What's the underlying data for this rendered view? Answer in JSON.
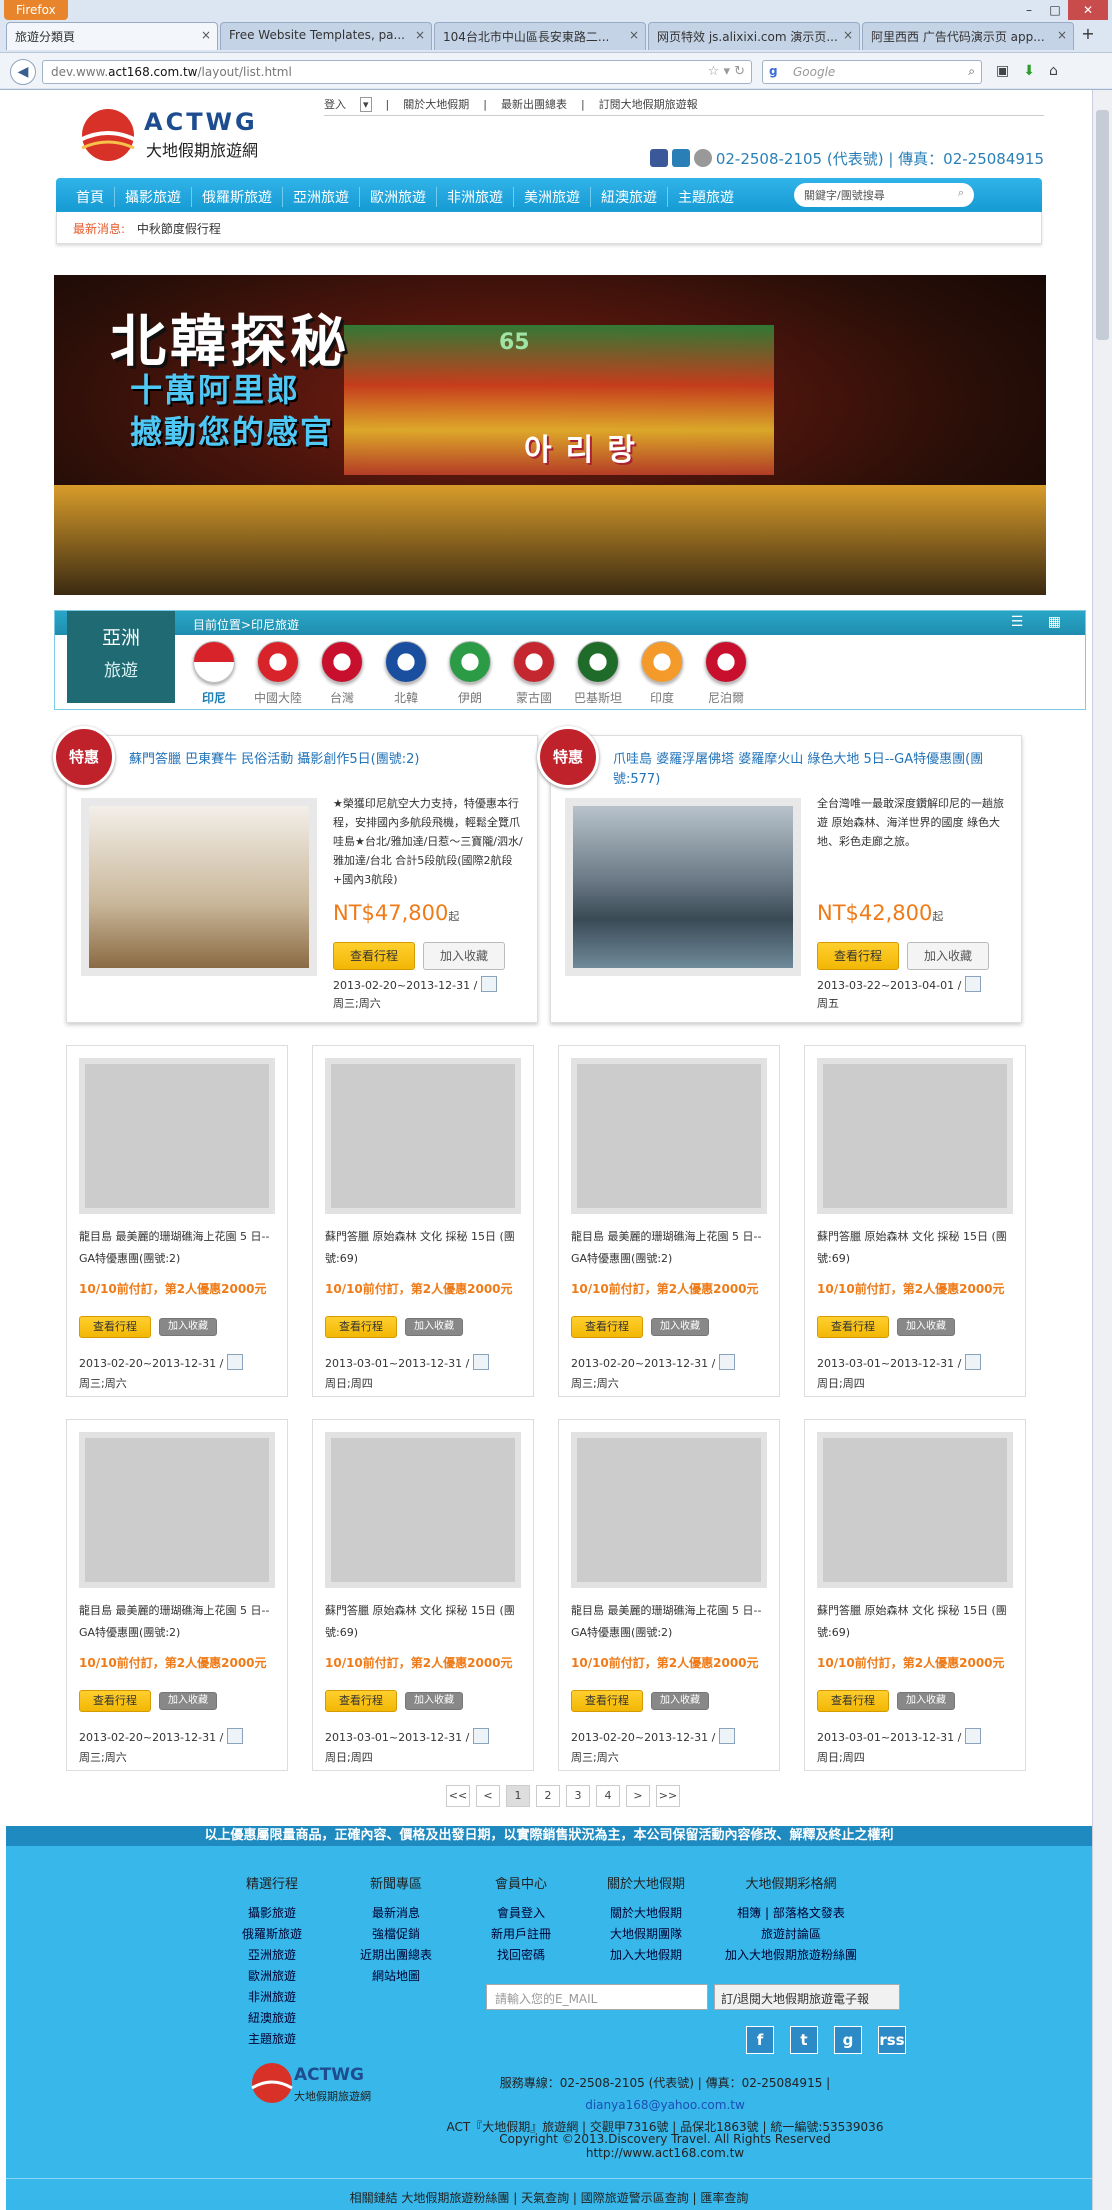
{
  "browser": {
    "menu_button": "Firefox",
    "tabs": [
      "旅遊分類頁",
      "Free Website Templates, pa...",
      "104台北市中山區長安東路二...",
      "网页特效 js.alixixi.com 演示页...",
      "阿里西西 广告代码演示页 app..."
    ],
    "url_prefix": "dev.www.",
    "url_domain": "act168.com.tw",
    "url_path": "/layout/list.html",
    "search_placeholder": "Google"
  },
  "header": {
    "top_links": [
      "登入",
      "關於大地假期",
      "最新出團總表",
      "訂閱大地假期旅遊報"
    ],
    "logo_text": "ACTWG",
    "logo_sub": "大地假期旅遊網",
    "phone": "02-2508-2105 (代表號) | 傳真：02-25084915"
  },
  "nav": {
    "items": [
      "首頁",
      "攝影旅遊",
      "俄羅斯旅遊",
      "亞洲旅遊",
      "歐洲旅遊",
      "非洲旅遊",
      "美洲旅遊",
      "紐澳旅遊",
      "主題旅遊"
    ],
    "keyword_placeholder": "關鍵字/團號搜尋"
  },
  "news": {
    "label": "最新消息:",
    "text": "中秋節度假行程"
  },
  "banner": {
    "title": "北韓探秘",
    "line1": "十萬阿里郎",
    "line2": "撼動您的感官",
    "number": "65",
    "korean": "아리랑"
  },
  "region": {
    "badge_top": "亞洲",
    "badge_bottom": "旅遊",
    "breadcrumb": "目前位置>印尼旅遊",
    "flags": [
      {
        "name": "印尼",
        "color": "#d8232a",
        "selected": true
      },
      {
        "name": "中國大陸",
        "color": "#d8232a"
      },
      {
        "name": "台灣",
        "color": "#c8102e"
      },
      {
        "name": "北韓",
        "color": "#1a4fa0"
      },
      {
        "name": "伊朗",
        "color": "#2c9b46"
      },
      {
        "name": "蒙古國",
        "color": "#c4272f"
      },
      {
        "name": "巴基斯坦",
        "color": "#1f6b2a"
      },
      {
        "name": "印度",
        "color": "#f39a2b"
      },
      {
        "name": "尼泊爾",
        "color": "#c8102e"
      }
    ]
  },
  "featured": [
    {
      "ribbon": "特惠",
      "title": "蘇門答臘 巴東賽牛 民俗活動 攝影創作5日(團號:2)",
      "desc": "★榮獲印尼航空大力支持，特優惠本行程，安排國內多航段飛機，輕鬆全覽爪哇島★台北/雅加達/日惹～三寶隴/泗水/雅加達/台北 合計5段航段(國際2航段+國內3航段)",
      "price": "NT$47,800",
      "price_suffix": "起",
      "btn_view": "查看行程",
      "btn_fav": "加入收藏",
      "date": "2013-02-20~2013-12-31 /",
      "days": "周三;周六"
    },
    {
      "ribbon": "特惠",
      "title": "爪哇島 婆羅浮屠佛塔 婆羅摩火山 綠色大地 5日--GA特優惠團(團號:577)",
      "desc": "全台灣唯一最敢深度鑽解印尼的一趟旅遊 原始森林、海洋世界的國度 綠色大地、彩色走廊之旅。",
      "price": "NT$42,800",
      "price_suffix": "起",
      "btn_view": "查看行程",
      "btn_fav": "加入收藏",
      "date": "2013-03-22~2013-04-01 /",
      "days": "周五"
    }
  ],
  "cards": [
    {
      "title": "龍目島 最美麗的珊瑚礁海上花園 5 日--GA特優惠團(團號:2)",
      "promo": "10/10前付訂，第2人優惠2000元",
      "btn_view": "查看行程",
      "btn_fav": "加入收藏",
      "date": "2013-02-20~2013-12-31 /",
      "days": "周三;周六",
      "img": "pool"
    },
    {
      "title": "蘇門答臘 原始森林 文化 採秘 15日 (團號:69)",
      "promo": "10/10前付訂，第2人優惠2000元",
      "btn_view": "查看行程",
      "btn_fav": "加入收藏",
      "date": "2013-03-01~2013-12-31 /",
      "days": "周日;周四",
      "img": "hill"
    },
    {
      "title": "龍目島 最美麗的珊瑚礁海上花園 5 日--GA特優惠團(團號:2)",
      "promo": "10/10前付訂，第2人優惠2000元",
      "btn_view": "查看行程",
      "btn_fav": "加入收藏",
      "date": "2013-02-20~2013-12-31 /",
      "days": "周三;周六",
      "img": "pool"
    },
    {
      "title": "蘇門答臘 原始森林 文化 採秘 15日 (團號:69)",
      "promo": "10/10前付訂，第2人優惠2000元",
      "btn_view": "查看行程",
      "btn_fav": "加入收藏",
      "date": "2013-03-01~2013-12-31 /",
      "days": "周日;周四",
      "img": "hill"
    },
    {
      "title": "龍目島 最美麗的珊瑚礁海上花園 5 日--GA特優惠團(團號:2)",
      "promo": "10/10前付訂，第2人優惠2000元",
      "btn_view": "查看行程",
      "btn_fav": "加入收藏",
      "date": "2013-02-20~2013-12-31 /",
      "days": "周三;周六",
      "img": "pool"
    },
    {
      "title": "蘇門答臘 原始森林 文化 採秘 15日 (團號:69)",
      "promo": "10/10前付訂，第2人優惠2000元",
      "btn_view": "查看行程",
      "btn_fav": "加入收藏",
      "date": "2013-03-01~2013-12-31 /",
      "days": "周日;周四",
      "img": "hill"
    },
    {
      "title": "龍目島 最美麗的珊瑚礁海上花園 5 日--GA特優惠團(團號:2)",
      "promo": "10/10前付訂，第2人優惠2000元",
      "btn_view": "查看行程",
      "btn_fav": "加入收藏",
      "date": "2013-02-20~2013-12-31 /",
      "days": "周三;周六",
      "img": "pool"
    },
    {
      "title": "蘇門答臘 原始森林 文化 採秘 15日 (團號:69)",
      "promo": "10/10前付訂，第2人優惠2000元",
      "btn_view": "查看行程",
      "btn_fav": "加入收藏",
      "date": "2013-03-01~2013-12-31 /",
      "days": "周日;周四",
      "img": "hill"
    }
  ],
  "pager": [
    "<<",
    "<",
    "1",
    "2",
    "3",
    "4",
    ">",
    ">>"
  ],
  "pager_current": "1",
  "footer": {
    "notice": "以上優惠屬限量商品，正確內容、價格及出發日期，以實際銷售狀況為主，本公司保留活動內容修改、解釋及終止之權利",
    "cols": [
      {
        "head": "精選行程",
        "items": [
          "攝影旅遊",
          "俄羅斯旅遊",
          "亞洲旅遊",
          "歐洲旅遊",
          "非洲旅遊",
          "紐澳旅遊",
          "主題旅遊"
        ]
      },
      {
        "head": "新聞專區",
        "items": [
          "最新消息",
          "強檔促銷",
          "近期出團總表",
          "網站地圖"
        ]
      },
      {
        "head": "會員中心",
        "items": [
          "會員登入",
          "新用戶註冊",
          "找回密碼"
        ]
      },
      {
        "head": "關於大地假期",
        "items": [
          "關於大地假期",
          "大地假期團隊",
          "加入大地假期"
        ]
      },
      {
        "head": "大地假期彩格網",
        "items": [
          "相簿 | 部落格文發表",
          "旅遊討論區",
          "加入大地假期旅遊粉絲團"
        ]
      }
    ],
    "newsletter_placeholder": "請輸入您的E_MAIL",
    "newsletter_button": "訂/退閱大地假期旅遊電子報",
    "social": [
      "f",
      "t",
      "g",
      "rss"
    ],
    "service_line": "服務專線：02-2508-2105 (代表號) | 傳真：02-25084915 |",
    "email": "dianya168@yahoo.com.tw",
    "license_line": "ACT『大地假期』旅遊網 | 交觀甲7316號 | 品保北1863號 | 統一編號:53539036",
    "copyright": "Copyright ©2013.Discovery Travel. All Rights Reserved http://www.act168.com.tw",
    "bottom_links": "相關鏈結 大地假期旅遊粉絲團 | 天氣查詢 | 國際旅遊警示區查詢 | 匯率查詢"
  }
}
